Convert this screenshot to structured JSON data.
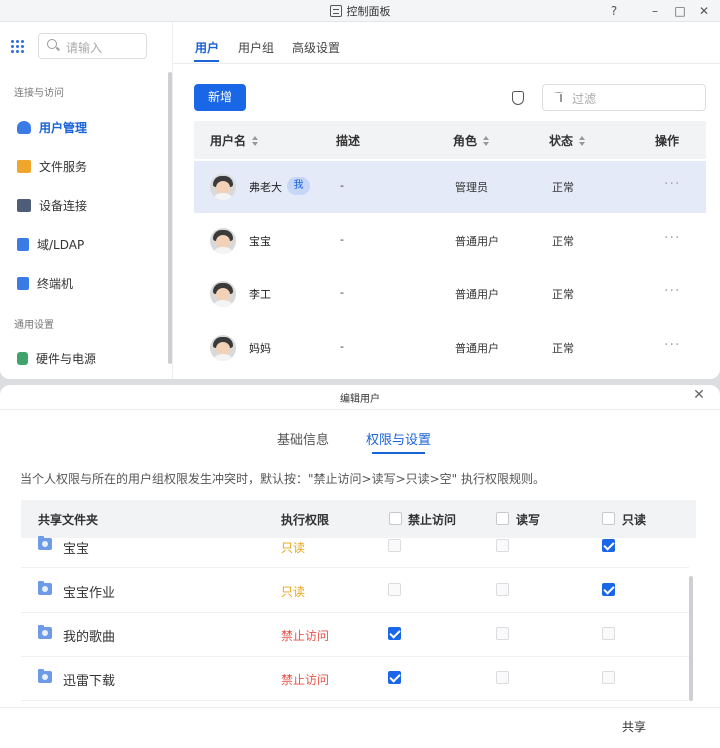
{
  "window": {
    "title": "控制面板",
    "controls": [
      "?",
      "–",
      "□",
      "✕"
    ]
  },
  "sidebar": {
    "search_placeholder": "请输入",
    "sections": [
      {
        "label": "连接与访问"
      },
      {
        "label": "通用设置"
      }
    ],
    "items": [
      {
        "label": "用户管理",
        "icon": "user-icon",
        "active": true,
        "color": "#3b7be6"
      },
      {
        "label": "文件服务",
        "icon": "folder-icon",
        "active": false,
        "color": "#f0a52b"
      },
      {
        "label": "设备连接",
        "icon": "device-icon",
        "active": false,
        "color": "#4e5d78"
      },
      {
        "label": "域/LDAP",
        "icon": "domain-icon",
        "active": false,
        "color": "#3b7be6"
      },
      {
        "label": "终端机",
        "icon": "terminal-icon",
        "active": false,
        "color": "#3b7be6"
      },
      {
        "label": "硬件与电源",
        "icon": "hardware-icon",
        "active": false,
        "color": "#3fa36b"
      }
    ]
  },
  "tabs": [
    {
      "label": "用户",
      "active": true
    },
    {
      "label": "用户组",
      "active": false
    },
    {
      "label": "高级设置",
      "active": false
    }
  ],
  "toolbar": {
    "new_button": "新增",
    "filter_placeholder": "过滤"
  },
  "user_table": {
    "headers": [
      "用户名",
      "描述",
      "角色",
      "状态",
      "操作"
    ],
    "rows": [
      {
        "name": "弗老大",
        "badge": "我",
        "desc": "-",
        "role": "管理员",
        "status": "正常",
        "actions": "···",
        "selected": true
      },
      {
        "name": "宝宝",
        "badge": "",
        "desc": "-",
        "role": "普通用户",
        "status": "正常",
        "actions": "···",
        "selected": false
      },
      {
        "name": "李工",
        "badge": "",
        "desc": "-",
        "role": "普通用户",
        "status": "正常",
        "actions": "···",
        "selected": false
      },
      {
        "name": "妈妈",
        "badge": "",
        "desc": "-",
        "role": "普通用户",
        "status": "正常",
        "actions": "···",
        "selected": false
      }
    ]
  },
  "dialog": {
    "title": "编辑用户",
    "close": "✕",
    "tabs": [
      {
        "label": "基础信息",
        "active": false
      },
      {
        "label": "权限与设置",
        "active": true
      }
    ],
    "notice": "当个人权限与所在的用户组权限发生冲突时，默认按：\"禁止访问>读写>只读>空\" 执行权限规则。",
    "headers": {
      "folder": "共享文件夹",
      "perm": "执行权限",
      "deny": "禁止访问",
      "rw": "读写",
      "ro": "只读"
    },
    "rows": [
      {
        "folder": "宝宝",
        "perm": "只读",
        "perm_type": "readonly",
        "deny": false,
        "rw": false,
        "ro": true
      },
      {
        "folder": "宝宝作业",
        "perm": "只读",
        "perm_type": "readonly",
        "deny": false,
        "rw": false,
        "ro": true
      },
      {
        "folder": "我的歌曲",
        "perm": "禁止访问",
        "perm_type": "deny",
        "deny": true,
        "rw": false,
        "ro": false
      },
      {
        "folder": "迅雷下载",
        "perm": "禁止访问",
        "perm_type": "deny",
        "deny": true,
        "rw": false,
        "ro": false
      }
    ],
    "footer_button": "共享"
  },
  "colors": {
    "accent": "#1967e6",
    "readonly": "#e8a51a",
    "deny": "#e8534a",
    "selected_row": "#e4eaf8"
  }
}
